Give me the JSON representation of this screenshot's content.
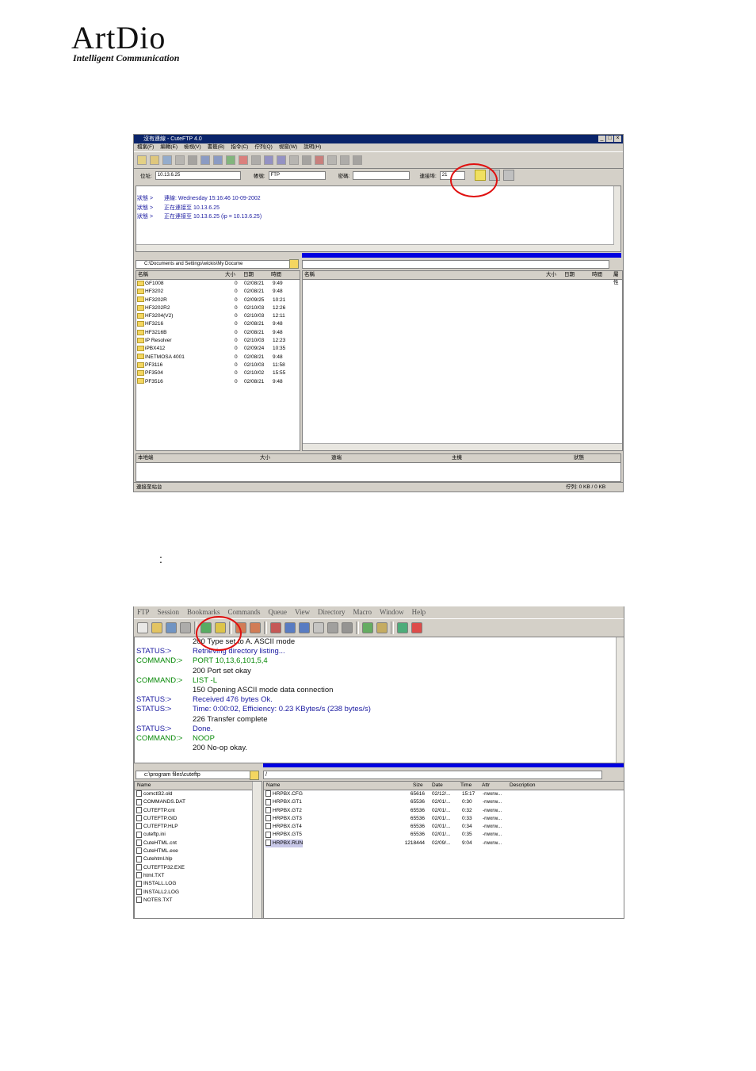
{
  "logo": {
    "word": "ArtDio",
    "tagline": "Intelligent Communication"
  },
  "caption_colon": ":",
  "shot1": {
    "title": "沒有連線 - CuteFTP 4.0",
    "menu": [
      "檔案(F)",
      "編輯(E)",
      "檢視(V)",
      "書籤(B)",
      "指令(C)",
      "佇列(Q)",
      "視窗(W)",
      "說明(H)"
    ],
    "address_label": "位址:",
    "address_value": "10.13.6.25",
    "user_label": "帳號:",
    "user_value": "FTP",
    "pass_label": "密碼:",
    "pass_value": "",
    "port_label": "連接埠:",
    "port_value": "21",
    "connect_tooltip": "連線",
    "log": [
      {
        "label": "狀態 >",
        "msg": "連線: Wednesday 15:16:46 10-09-2002"
      },
      {
        "label": "狀態 >",
        "msg": "正在連接至 10.13.6.25"
      },
      {
        "label": "狀態 >",
        "msg": "正在連接至 10.13.6.25 (ip = 10.13.6.25)"
      }
    ],
    "local_path": "C:\\Documents and Settings\\wickis\\My Docume",
    "local_cols": [
      "名稱",
      "大小",
      "日期",
      "時間"
    ],
    "remote_cols": [
      "名稱",
      "大小",
      "日期",
      "時間",
      "屬性"
    ],
    "local_files": [
      {
        "name": "GF1008",
        "size": "0",
        "date": "02/08/21",
        "time": "9:49"
      },
      {
        "name": "HF3202",
        "size": "0",
        "date": "02/08/21",
        "time": "9:48"
      },
      {
        "name": "HF3202R",
        "size": "0",
        "date": "02/09/25",
        "time": "10:21"
      },
      {
        "name": "HF3202R2",
        "size": "0",
        "date": "02/10/03",
        "time": "12:26"
      },
      {
        "name": "HF3204(V2)",
        "size": "0",
        "date": "02/10/03",
        "time": "12:11"
      },
      {
        "name": "HF3216",
        "size": "0",
        "date": "02/08/21",
        "time": "9:48"
      },
      {
        "name": "HF3216B",
        "size": "0",
        "date": "02/08/21",
        "time": "9:48"
      },
      {
        "name": "IP Resolver",
        "size": "0",
        "date": "02/10/03",
        "time": "12:23"
      },
      {
        "name": "iPBX412",
        "size": "0",
        "date": "02/09/24",
        "time": "10:35"
      },
      {
        "name": "INETMOSA 4001",
        "size": "0",
        "date": "02/08/21",
        "time": "9:48"
      },
      {
        "name": "PF3116",
        "size": "0",
        "date": "02/10/03",
        "time": "11:58"
      },
      {
        "name": "PF3504",
        "size": "0",
        "date": "02/10/02",
        "time": "15:55"
      },
      {
        "name": "PF3516",
        "size": "0",
        "date": "02/08/21",
        "time": "9:48"
      }
    ],
    "queue_cols": [
      "本地端",
      "大小",
      "遠端",
      "主機",
      "狀態"
    ],
    "status_left": "連接至站台",
    "status_right": "佇列: 0 KB / 0 KB"
  },
  "shot2": {
    "menu": [
      "FTP",
      "Session",
      "Bookmarks",
      "Commands",
      "Queue",
      "View",
      "Directory",
      "Macro",
      "Window",
      "Help"
    ],
    "log": [
      {
        "label": "",
        "msg": "200 Type set to A. ASCII mode",
        "kind": "blk"
      },
      {
        "label": "STATUS:>",
        "msg": "Retrieving directory listing...",
        "kind": "blue"
      },
      {
        "label": "COMMAND:>",
        "msg": "PORT 10,13,6,101,5,4",
        "kind": "green"
      },
      {
        "label": "",
        "msg": "200 Port set okay",
        "kind": "blk"
      },
      {
        "label": "COMMAND:>",
        "msg": "LIST -L",
        "kind": "green"
      },
      {
        "label": "",
        "msg": "150 Opening ASCII mode data connection",
        "kind": "blk"
      },
      {
        "label": "STATUS:>",
        "msg": "Received 476 bytes Ok.",
        "kind": "blue"
      },
      {
        "label": "STATUS:>",
        "msg": "Time: 0:00:02, Efficiency: 0.23 KBytes/s (238 bytes/s)",
        "kind": "blue"
      },
      {
        "label": "",
        "msg": "226 Transfer complete",
        "kind": "blk"
      },
      {
        "label": "STATUS:>",
        "msg": "Done.",
        "kind": "blue"
      },
      {
        "label": "COMMAND:>",
        "msg": "NOOP",
        "kind": "green"
      },
      {
        "label": "",
        "msg": "200 No-op okay.",
        "kind": "blk"
      }
    ],
    "local_path": "c:\\program files\\cuteftp",
    "local_cols": [
      "Name"
    ],
    "local_files": [
      "comctl32.old",
      "COMMANDS.DAT",
      "CUTEFTP.cnt",
      "CUTEFTP.GID",
      "CUTEFTP.HLP",
      "cuteftp.ini",
      "CuteHTML.cnt",
      "CuteHTML.exe",
      "Cutehtml.hlp",
      "CUTEFTP32.EXE",
      "html.TXT",
      "INSTALL.LOG",
      "INSTALL2.LOG",
      "NOTES.TXT"
    ],
    "remote_path": "/",
    "remote_cols": [
      "Name",
      "Size",
      "Date",
      "Time",
      "Attr",
      "Description"
    ],
    "remote_files": [
      {
        "name": "HRPBX.CFG",
        "size": "65616",
        "date": "02/12/...",
        "time": "15:17",
        "attr": "-rwxrw..."
      },
      {
        "name": "HRPBX.GT1",
        "size": "65536",
        "date": "02/01/...",
        "time": "0:30",
        "attr": "-rwxrw..."
      },
      {
        "name": "HRPBX.GT2",
        "size": "65536",
        "date": "02/01/...",
        "time": "0:32",
        "attr": "-rwxrw..."
      },
      {
        "name": "HRPBX.GT3",
        "size": "65536",
        "date": "02/01/...",
        "time": "0:33",
        "attr": "-rwxrw..."
      },
      {
        "name": "HRPBX.GT4",
        "size": "65536",
        "date": "02/01/...",
        "time": "0:34",
        "attr": "-rwxrw..."
      },
      {
        "name": "HRPBX.GT5",
        "size": "65536",
        "date": "02/01/...",
        "time": "0:35",
        "attr": "-rwxrw..."
      },
      {
        "name": "HRPBX.RUN",
        "size": "1218444",
        "date": "02/09/...",
        "time": "9:04",
        "attr": "-rwxrw..."
      }
    ]
  }
}
